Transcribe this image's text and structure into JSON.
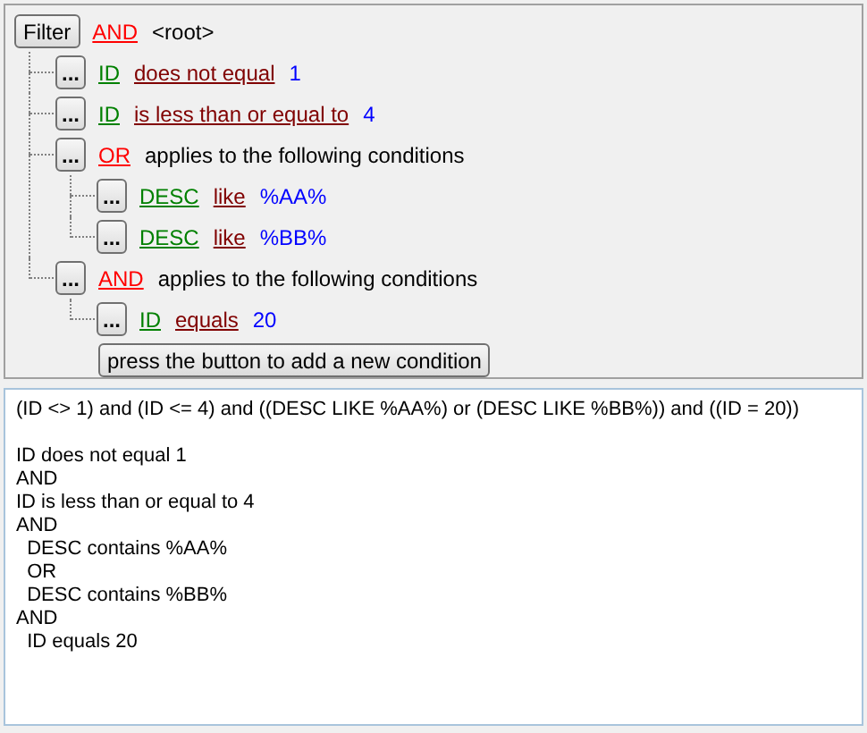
{
  "filter_tree": {
    "button": "Filter",
    "operator": "AND",
    "label": "<root>",
    "children": [
      {
        "kind": "condition",
        "menu_button": "...",
        "field": "ID",
        "operator": "does not equal",
        "value": "1"
      },
      {
        "kind": "condition",
        "menu_button": "...",
        "field": "ID",
        "operator": "is less than or equal to",
        "value": "4"
      },
      {
        "kind": "group",
        "menu_button": "...",
        "operator": "OR",
        "label": "applies to the following conditions",
        "children": [
          {
            "kind": "condition",
            "menu_button": "...",
            "field": "DESC",
            "operator": "like",
            "value": "%AA%"
          },
          {
            "kind": "condition",
            "menu_button": "...",
            "field": "DESC",
            "operator": "like",
            "value": "%BB%"
          }
        ]
      },
      {
        "kind": "group",
        "menu_button": "...",
        "operator": "AND",
        "label": "applies to the following conditions",
        "children": [
          {
            "kind": "condition",
            "menu_button": "...",
            "field": "ID",
            "operator": "equals",
            "value": "20"
          }
        ]
      }
    ],
    "add_button": "press the button to add a new condition"
  },
  "query_text": {
    "sql": "(ID <> 1) and (ID <= 4) and ((DESC LIKE %AA%) or (DESC LIKE %BB%)) and ((ID = 20))",
    "description": [
      "ID does not equal 1",
      "AND",
      "ID is less than or equal to 4",
      "AND",
      "  DESC contains %AA%",
      "  OR",
      "  DESC contains %BB%",
      "AND",
      "  ID equals 20"
    ]
  }
}
